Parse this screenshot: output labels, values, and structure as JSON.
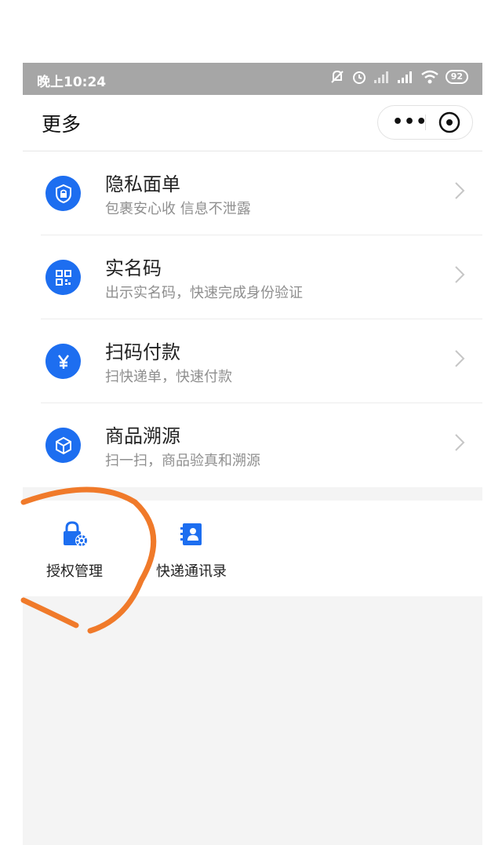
{
  "status_bar": {
    "time": "晚上10:24",
    "battery": "92"
  },
  "header": {
    "title": "更多",
    "more_label": "•••"
  },
  "list": [
    {
      "title": "隐私面单",
      "subtitle": "包裹安心收 信息不泄露",
      "icon": "shield-lock-icon"
    },
    {
      "title": "实名码",
      "subtitle": "出示实名码，快速完成身份验证",
      "icon": "qr-code-icon"
    },
    {
      "title": "扫码付款",
      "subtitle": "扫快递单，快速付款",
      "icon": "yuan-icon"
    },
    {
      "title": "商品溯源",
      "subtitle": "扫一扫，商品验真和溯源",
      "icon": "box-icon"
    }
  ],
  "grid": [
    {
      "label": "授权管理",
      "icon": "lock-gear-icon"
    },
    {
      "label": "快递通讯录",
      "icon": "contacts-icon"
    }
  ],
  "colors": {
    "accent": "#1d6ef0",
    "annotation": "#f07a2a"
  }
}
